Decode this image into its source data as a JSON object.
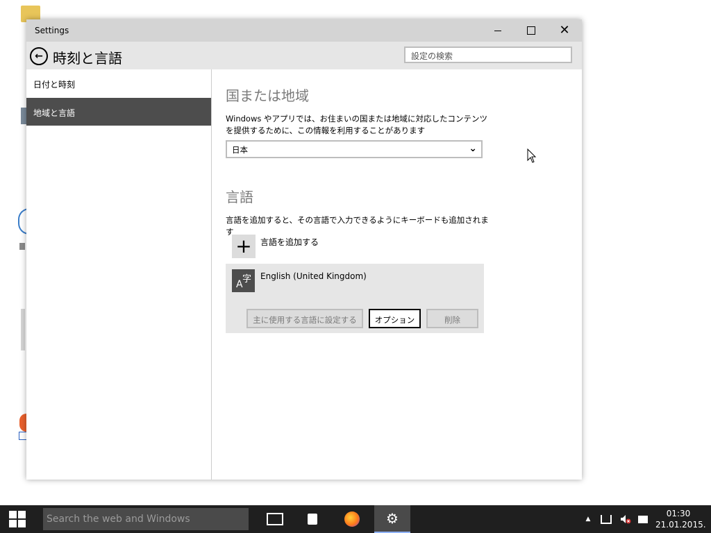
{
  "window": {
    "title": "Settings",
    "close_glyph": "✕",
    "controls": [
      "minimize-icon",
      "maximize-icon",
      "close-icon"
    ]
  },
  "header": {
    "back_glyph": "←",
    "title": "時刻と言語",
    "search_placeholder": "設定の検索"
  },
  "sidebar": {
    "items": [
      {
        "label": "日付と時刻",
        "selected": false
      },
      {
        "label": "地域と言語",
        "selected": true
      }
    ]
  },
  "region": {
    "heading": "国または地域",
    "description": "Windows やアプリでは、お住まいの国または地域に対応したコンテンツを提供するために、この情報を利用することがあります",
    "selected_value": "日本",
    "chevron_glyph": "⌄"
  },
  "language": {
    "heading": "言語",
    "description": "言語を追加すると、その言語で入力できるようにキーボードも追加されます",
    "add_glyph": "+",
    "add_label": "言語を追加する",
    "entries": [
      {
        "icon_a": "A",
        "icon_char": "字",
        "name": "English (United Kingdom)",
        "buttons": {
          "primary": "主に使用する言語に設定する",
          "options": "オプション",
          "remove": "削除"
        }
      }
    ]
  },
  "taskbar": {
    "search_placeholder": "Search the web and Windows",
    "settings_glyph": "⚙",
    "tray_up_glyph": "▲",
    "time": "01:30",
    "date": "21.01.2015."
  },
  "colors": {
    "accent_selected": "#4d4d4d",
    "taskbar_bg": "#1f1f1f",
    "section_heading": "#7a7a7a"
  }
}
